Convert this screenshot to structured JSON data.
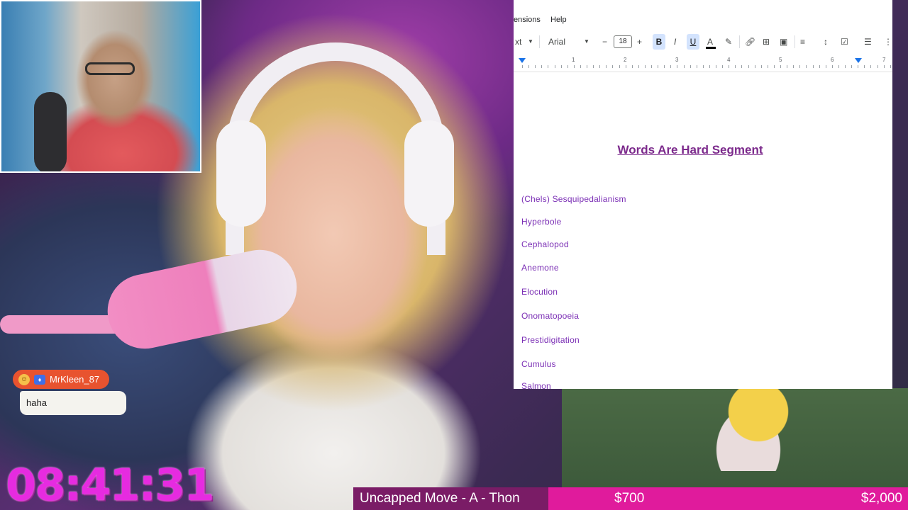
{
  "docs": {
    "menu": [
      "ensions",
      "Help"
    ],
    "toolbar": {
      "style_label": "xt",
      "font_name": "Arial",
      "font_size": "18",
      "minus_label": "−",
      "plus_label": "+",
      "bold_label": "B",
      "italic_label": "I",
      "underline_label": "U",
      "text_color_label": "A"
    },
    "ruler_numbers": [
      "1",
      "2",
      "3",
      "4",
      "5",
      "6",
      "7"
    ],
    "title": "Words Are Hard Segment",
    "words": [
      "(Chels) Sesquipedalianism",
      "Hyperbole",
      "Cephalopod",
      "Anemone",
      "Elocution",
      "Onomatopoeia",
      "Prestidigitation",
      "Cumulus",
      "Salmon"
    ]
  },
  "chat": {
    "username": "MrKleen_87",
    "message": "haha"
  },
  "timer": "08:41:31",
  "goal": {
    "title": "Uncapped Move - A - Thon",
    "current": "$700",
    "target": "$2,000",
    "progress_fraction": 0.35
  },
  "colors": {
    "timer": "#e62be0",
    "goal_bar": "#e01b9c",
    "doc_title": "#7c2a8c",
    "doc_words": "#7b2fb5",
    "chat_name_bg": "#e8532f"
  }
}
